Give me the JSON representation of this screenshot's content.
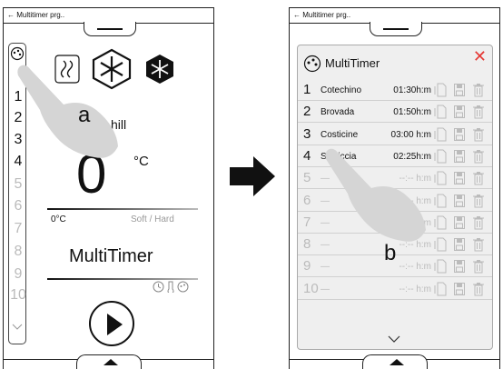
{
  "left_screen": {
    "title": "← Multitimer prg..",
    "numbers": [
      "1",
      "2",
      "3",
      "4",
      "5",
      "6",
      "7",
      "8",
      "9",
      "10"
    ],
    "temp_value": "0",
    "temp_unit": "°C",
    "temp_left_label": "0°C",
    "temp_right_label": "Soft / Hard",
    "mode_text": "hill",
    "program_name": "MultiTimer",
    "callout": "a"
  },
  "right_screen": {
    "title": "← Multitimer prg..",
    "panel_title": "MultiTimer",
    "close_glyph": "✕",
    "rows": [
      {
        "n": "1",
        "name": "Cotechino",
        "time": "01:30h:m",
        "active": true
      },
      {
        "n": "2",
        "name": "Brovada",
        "time": "01:50h:m",
        "active": true
      },
      {
        "n": "3",
        "name": "Costicine",
        "time": "03:00 h:m",
        "active": true
      },
      {
        "n": "4",
        "name": "Salsiccia",
        "time": "02:25h:m",
        "active": true
      },
      {
        "n": "5",
        "name": "—",
        "time": "--:-- h:m",
        "active": false
      },
      {
        "n": "6",
        "name": "—",
        "time": "--:-- h:m",
        "active": false
      },
      {
        "n": "7",
        "name": "—",
        "time": "--:-- h:m",
        "active": false
      },
      {
        "n": "8",
        "name": "—",
        "time": "--:-- h:m",
        "active": false
      },
      {
        "n": "9",
        "name": "—",
        "time": "--:-- h:m",
        "active": false
      },
      {
        "n": "10",
        "name": "—",
        "time": "--:-- h:m",
        "active": false
      }
    ],
    "callout": "b"
  },
  "colors": {
    "close": "#e53935",
    "panel": "#efefef",
    "hand": "#d5d5d5"
  }
}
